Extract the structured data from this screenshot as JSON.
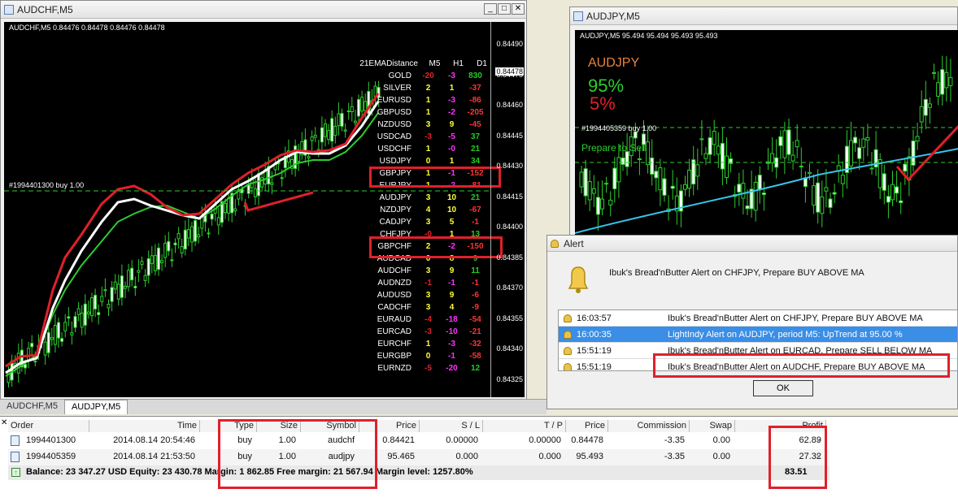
{
  "left_window": {
    "title": "AUDCHF,M5",
    "chart_header": "AUDCHF,M5  0.84476 0.84478 0.84476 0.84478",
    "order_label": "#1994401300 buy 1.00",
    "current_price": "0.84478",
    "price_labels": [
      "0.84490",
      "0.84475",
      "0.84460",
      "0.84445",
      "0.84430",
      "0.84415",
      "0.84400",
      "0.84385",
      "0.84370",
      "0.84355",
      "0.84340",
      "0.84325"
    ],
    "table_header": {
      "title": "21EMADistance",
      "c1": "M5",
      "c2": "H1",
      "c3": "D1"
    },
    "rows": [
      {
        "s": "GOLD",
        "a": "-20",
        "b": "-3",
        "c": "830"
      },
      {
        "s": "SILVER",
        "a": "2",
        "b": "1",
        "c": "-37"
      },
      {
        "s": "EURUSD",
        "a": "1",
        "b": "-3",
        "c": "-86"
      },
      {
        "s": "GBPUSD",
        "a": "1",
        "b": "-2",
        "c": "-205"
      },
      {
        "s": "NZDUSD",
        "a": "3",
        "b": "9",
        "c": "-45"
      },
      {
        "s": "USDCAD",
        "a": "-3",
        "b": "-5",
        "c": "37"
      },
      {
        "s": "USDCHF",
        "a": "1",
        "b": "-0",
        "c": "21"
      },
      {
        "s": "USDJPY",
        "a": "0",
        "b": "1",
        "c": "34"
      },
      {
        "s": "GBPJPY",
        "a": "1",
        "b": "-1",
        "c": "-152"
      },
      {
        "s": "EURJPY",
        "a": "1",
        "b": "-2",
        "c": "-81"
      },
      {
        "s": "AUDJPY",
        "a": "3",
        "b": "10",
        "c": "21"
      },
      {
        "s": "NZDJPY",
        "a": "4",
        "b": "10",
        "c": "-67"
      },
      {
        "s": "CADJPY",
        "a": "3",
        "b": "5",
        "c": "-1"
      },
      {
        "s": "CHFJPY",
        "a": "-0",
        "b": "1",
        "c": "13"
      },
      {
        "s": "GBPCHF",
        "a": "2",
        "b": "-2",
        "c": "-150"
      },
      {
        "s": "AUDCAD",
        "a": "0",
        "b": "8",
        "c": "9"
      },
      {
        "s": "AUDCHF",
        "a": "3",
        "b": "9",
        "c": "11"
      },
      {
        "s": "AUDNZD",
        "a": "-1",
        "b": "-1",
        "c": "-1"
      },
      {
        "s": "AUDUSD",
        "a": "3",
        "b": "9",
        "c": "-6"
      },
      {
        "s": "CADCHF",
        "a": "3",
        "b": "4",
        "c": "-9"
      },
      {
        "s": "EURAUD",
        "a": "-4",
        "b": "-18",
        "c": "-54"
      },
      {
        "s": "EURCAD",
        "a": "-3",
        "b": "-10",
        "c": "-21"
      },
      {
        "s": "EURCHF",
        "a": "1",
        "b": "-3",
        "c": "-32"
      },
      {
        "s": "EURGBP",
        "a": "0",
        "b": "-1",
        "c": "-58"
      },
      {
        "s": "EURNZD",
        "a": "-5",
        "b": "-20",
        "c": "12"
      }
    ]
  },
  "right_window": {
    "title": "AUDJPY,M5",
    "chart_header": "AUDJPY,M5  95.494 95.494 95.493 95.493",
    "symbol_label": "AUDJPY",
    "pct_up": "95%",
    "pct_down": "5%",
    "order_label": "#1994405359 buy 1.00",
    "prepare_label": "Prepare to Sell"
  },
  "alert": {
    "title": "Alert",
    "message": "Ibuk's Bread'nButter Alert on CHFJPY, Prepare BUY ABOVE MA",
    "entries": [
      {
        "time": "16:03:57",
        "text": "Ibuk's Bread'nButter Alert on CHFJPY, Prepare BUY ABOVE MA"
      },
      {
        "time": "16:00:35",
        "text": "LightIndy Alert on AUDJPY, period M5: UpTrend at 95.00 %"
      },
      {
        "time": "15:51:19",
        "text": "Ibuk's Bread'nButter Alert on EURCAD, Prepare SELL BELOW MA"
      },
      {
        "time": "15:51:19",
        "text": "Ibuk's Bread'nButter Alert on AUDCHF, Prepare BUY ABOVE MA"
      }
    ],
    "ok_label": "OK"
  },
  "tabs": [
    "AUDCHF,M5",
    "AUDJPY,M5"
  ],
  "terminal": {
    "headers": [
      "Order",
      "Time",
      "Type",
      "Size",
      "Symbol",
      "Price",
      "S / L",
      "T / P",
      "Price",
      "Commission",
      "Swap",
      "Profit"
    ],
    "rows": [
      {
        "order": "1994401300",
        "time": "2014.08.14 20:54:46",
        "type": "buy",
        "size": "1.00",
        "symbol": "audchf",
        "price": "0.84421",
        "sl": "0.00000",
        "tp": "0.00000",
        "cur": "0.84478",
        "comm": "-3.35",
        "swap": "0.00",
        "profit": "62.89"
      },
      {
        "order": "1994405359",
        "time": "2014.08.14 21:53:50",
        "type": "buy",
        "size": "1.00",
        "symbol": "audjpy",
        "price": "95.465",
        "sl": "0.000",
        "tp": "0.000",
        "cur": "95.493",
        "comm": "-3.35",
        "swap": "0.00",
        "profit": "27.32"
      }
    ],
    "balance_line": "Balance: 23 347.27 USD  Equity: 23 430.78  Margin: 1 862.85  Free margin: 21 567.94  Margin level: 1257.80%",
    "total_profit": "83.51"
  },
  "colors": {
    "annotation_red": "#e0202a",
    "ema_red": "#e0202a",
    "ema_white": "#ffffff",
    "ema_green": "#2ecc2e",
    "ma_cyan": "#35c6e8"
  }
}
